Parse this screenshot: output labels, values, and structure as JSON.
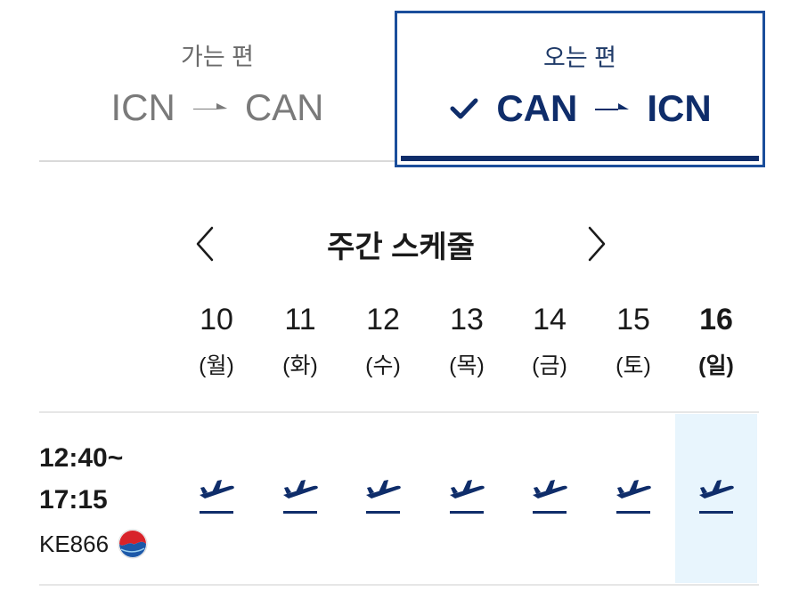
{
  "tabs": {
    "outbound": {
      "label": "가는 편",
      "from": "ICN",
      "to": "CAN"
    },
    "return": {
      "label": "오는 편",
      "from": "CAN",
      "to": "ICN",
      "selected": true
    }
  },
  "week": {
    "title": "주간 스케줄",
    "days": [
      {
        "num": "10",
        "weekday": "(월)"
      },
      {
        "num": "11",
        "weekday": "(화)"
      },
      {
        "num": "12",
        "weekday": "(수)"
      },
      {
        "num": "13",
        "weekday": "(목)"
      },
      {
        "num": "14",
        "weekday": "(금)"
      },
      {
        "num": "15",
        "weekday": "(토)"
      },
      {
        "num": "16",
        "weekday": "(일)"
      }
    ],
    "selected_day": "16"
  },
  "flight": {
    "time_line1": "12:40~",
    "time_line2": "17:15",
    "number": "KE866",
    "logo": "korean-air-logo"
  },
  "colors": {
    "accent": "#0f2d6a",
    "tab_border": "#1b4e9b",
    "selected_bg": "#e8f5fd"
  },
  "icons": {
    "check": "check-icon",
    "route_arrow": "arrow-right-icon",
    "prev": "chevron-left-icon",
    "next": "chevron-right-icon",
    "flight": "airplane-icon"
  }
}
